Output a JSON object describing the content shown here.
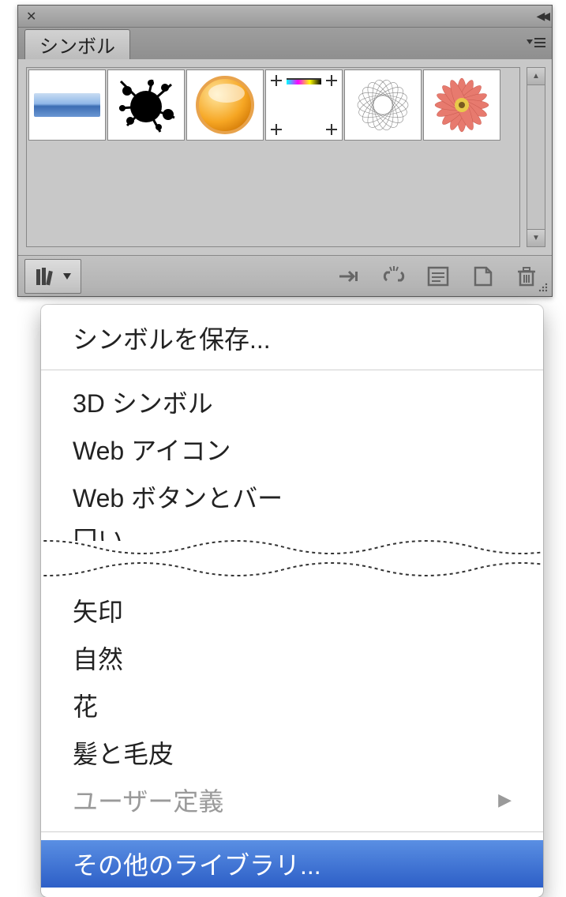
{
  "panel": {
    "tab_label": "シンボル",
    "symbols": [
      {
        "name": "gradient-bar"
      },
      {
        "name": "ink-splat"
      },
      {
        "name": "orange-orb"
      },
      {
        "name": "registration-marks"
      },
      {
        "name": "spirograph-ring"
      },
      {
        "name": "gerbera-flower"
      }
    ],
    "toolbar": {
      "library_button": "library",
      "place_instance": "place",
      "break_link": "break-link",
      "options": "options",
      "new_symbol": "new",
      "delete_symbol": "delete"
    }
  },
  "menu": {
    "save": "シンボルを保存...",
    "group1": [
      "3D シンボル",
      "Web アイコン",
      "Web ボタンとバー"
    ],
    "truncated_top": "囗い",
    "group2": [
      "矢印",
      "自然",
      "花",
      "髪と毛皮"
    ],
    "user_defined": "ユーザー定義",
    "other_libraries": "その他のライブラリ..."
  }
}
